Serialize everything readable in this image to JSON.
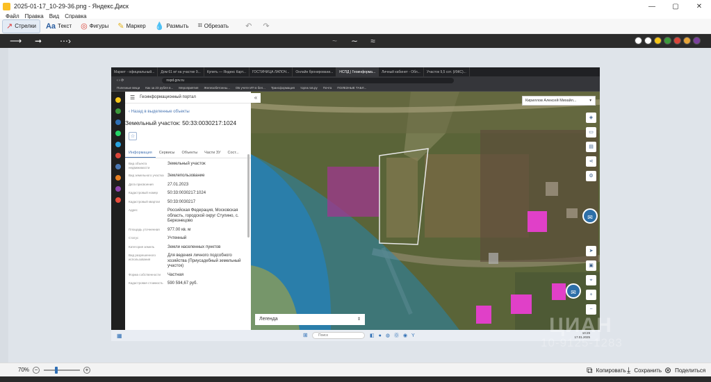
{
  "window": {
    "title": "2025-01-17_10-29-36.png - Яндекс.Диск",
    "minimize": "—",
    "maximize": "▢",
    "close": "✕"
  },
  "menu": [
    "Файл",
    "Правка",
    "Вид",
    "Справка"
  ],
  "toolbar": {
    "tools": [
      {
        "label": "Стрелки",
        "icon": "arrow-icon",
        "active": true
      },
      {
        "label": "Текст",
        "icon": "text-icon",
        "active": false
      },
      {
        "label": "Фигуры",
        "icon": "shapes-icon",
        "active": false
      },
      {
        "label": "Маркер",
        "icon": "marker-icon",
        "active": false
      },
      {
        "label": "Размыть",
        "icon": "blur-icon",
        "active": false
      },
      {
        "label": "Обрезать",
        "icon": "crop-icon",
        "active": false
      }
    ]
  },
  "palette": [
    "#ffffff",
    "#ffffff",
    "#f5c518",
    "#3c9a3c",
    "#d9453a",
    "#e6a43a",
    "#7a3f9d"
  ],
  "screenshot": {
    "tabs": [
      "Маркет - официальный...",
      "Дом 61 м² на участке 9...",
      "Купить — Яндекс Карт...",
      "ГОСТИНИЦА ЛАПОЧ...",
      "Онлайн бронировани...",
      "НСПД | Геоинформа...",
      "Личный кабинет - Обл...",
      "Участок 9,5 сот. (ИЖС)..."
    ],
    "active_tab_index": 5,
    "url": "nspd.gov.ru",
    "bookmarks": [
      "Полезные вещи",
      "Как за 23 рубля в...",
      "Мероприятия",
      "Железобетонны...",
      "ОБ учете ИП в бел...",
      "Трансформация",
      "торги.гов.ру",
      "Почта",
      "ПОЛЕЗНЫЕ ТАБЛ..."
    ],
    "portal_title": "Геоинформационный портал",
    "back_link": "Назад в выделенные объекты",
    "plot_title": "Земельный участок: 50:33:0030217:1024",
    "tabs_panel": [
      "Информация",
      "Сервисы",
      "Объекты",
      "Части ЗУ",
      "Сост..."
    ],
    "properties": [
      {
        "label": "Вид объекта недвижимости",
        "value": "Земельный участок"
      },
      {
        "label": "Вид земельного участка",
        "value": "Землепользование"
      },
      {
        "label": "Дата присвоения",
        "value": "27.01.2023"
      },
      {
        "label": "Кадастровый номер",
        "value": "50:33:0030217:1024"
      },
      {
        "label": "Кадастровый квартал",
        "value": "50:33:0030217"
      },
      {
        "label": "Адрес",
        "value": "Российская Федерация, Московская область, городской округ Ступино, с. Березнецово"
      },
      {
        "label": "Площадь уточненная",
        "value": "977.00 кв. м"
      },
      {
        "label": "Статус",
        "value": "Учтенный"
      },
      {
        "label": "Категория земель",
        "value": "Земли населенных пунктов"
      },
      {
        "label": "Вид разрешенного использования",
        "value": "Для ведения личного подсобного хозяйства (Приусадебный земельный участок)"
      },
      {
        "label": "Форма собственности",
        "value": "Частная"
      },
      {
        "label": "Кадастровая стоимость",
        "value": "590 594,67 руб."
      }
    ],
    "user_select": "Кириллов Алексей Михайл...",
    "legend": "Легенда",
    "taskbar_search": "Поиск",
    "clock_time": "10:29",
    "clock_date": "17.01.2025"
  },
  "watermark": {
    "top": "ЦИАН",
    "bottom": "10-9125-1283"
  },
  "zoom": "70%",
  "actions": [
    {
      "label": "Копировать",
      "icon": "copy-icon"
    },
    {
      "label": "Сохранить",
      "icon": "save-icon"
    },
    {
      "label": "Поделиться",
      "icon": "share-icon"
    }
  ]
}
